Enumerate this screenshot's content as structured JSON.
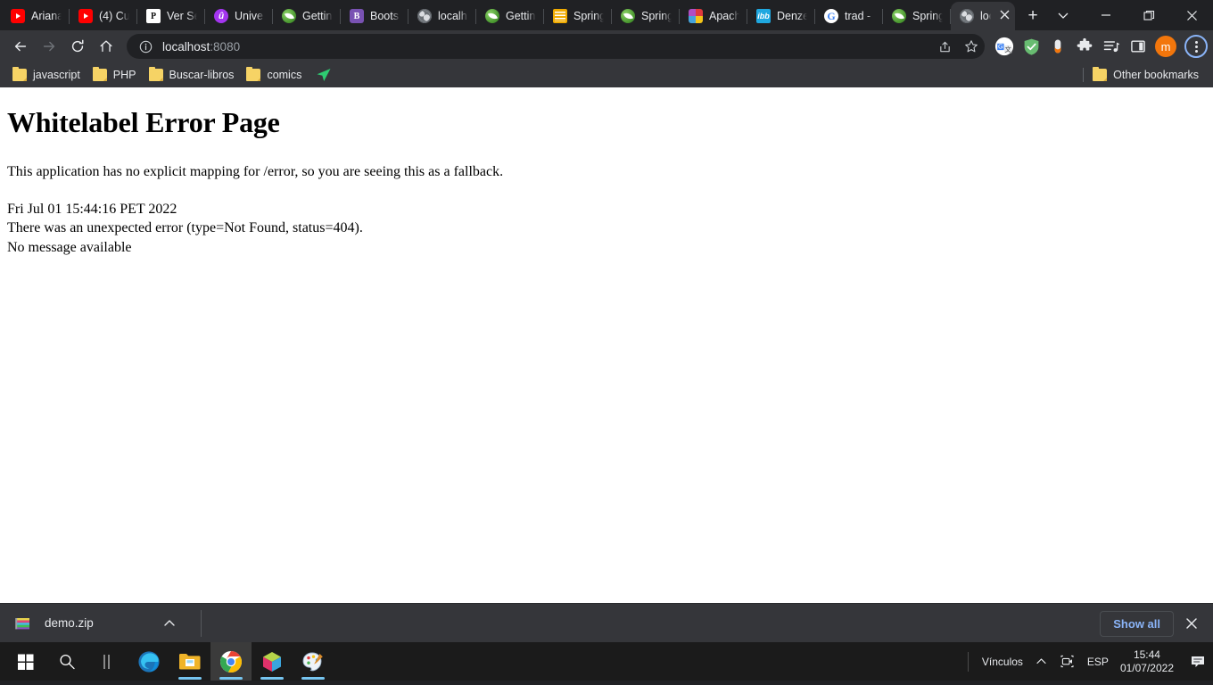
{
  "browser": {
    "tabs": [
      {
        "title": "Ariana",
        "favicon": "youtube-icon",
        "fav_class": "fav-yt",
        "glyph": ""
      },
      {
        "title": "(4) Cu",
        "favicon": "youtube-icon",
        "fav_class": "fav-yt",
        "glyph": ""
      },
      {
        "title": "Ver Se",
        "favicon": "p-letter-icon",
        "fav_class": "fav-p",
        "glyph": "P"
      },
      {
        "title": "Unive",
        "favicon": "udemy-icon",
        "fav_class": "fav-u",
        "glyph": "û"
      },
      {
        "title": "Gettin",
        "favicon": "spring-leaf-icon",
        "fav_class": "fav-spring",
        "glyph": ""
      },
      {
        "title": "Boots",
        "favicon": "bootstrap-icon",
        "fav_class": "fav-b",
        "glyph": "B"
      },
      {
        "title": "localh",
        "favicon": "globe-icon",
        "fav_class": "fav-globe",
        "glyph": ""
      },
      {
        "title": "Gettin",
        "favicon": "spring-leaf-icon",
        "fav_class": "fav-spring",
        "glyph": ""
      },
      {
        "title": "Spring",
        "favicon": "stack-icon",
        "fav_class": "fav-stack",
        "glyph": ""
      },
      {
        "title": "Spring",
        "favicon": "spring-leaf-icon",
        "fav_class": "fav-spring",
        "glyph": ""
      },
      {
        "title": "Apach",
        "favicon": "apache-cube-icon",
        "fav_class": "fav-apache",
        "glyph": ""
      },
      {
        "title": "Denze",
        "favicon": "ibb-icon",
        "fav_class": "fav-ibb",
        "glyph": "ibb"
      },
      {
        "title": "trad -",
        "favicon": "google-icon",
        "fav_class": "fav-g",
        "glyph": "G"
      },
      {
        "title": "Spring",
        "favicon": "spring-leaf-icon",
        "fav_class": "fav-spring",
        "glyph": ""
      }
    ],
    "active_tab": {
      "title": "loc",
      "favicon": "globe-icon",
      "fav_class": "fav-globe",
      "glyph": ""
    },
    "new_tab_label": "+",
    "window_controls": {
      "search_tabs": "⌄",
      "minimize": "—",
      "maximize": "❐",
      "close": "✕"
    },
    "omnibox": {
      "url_host": "localhost",
      "url_port": ":8080",
      "info_icon": "page-info-icon",
      "share_icon": "share-icon",
      "bookmark_icon": "star-icon"
    },
    "extensions": [
      {
        "name": "google-translate-icon"
      },
      {
        "name": "adguard-shield-icon"
      },
      {
        "name": "pill-capsule-icon"
      },
      {
        "name": "extensions-puzzle-icon"
      },
      {
        "name": "reading-list-icon"
      },
      {
        "name": "side-panel-icon"
      }
    ],
    "profile_initial": "m",
    "bookmarks": [
      {
        "label": "javascript",
        "icon": "folder-icon"
      },
      {
        "label": "PHP",
        "icon": "folder-icon"
      },
      {
        "label": "Buscar-libros",
        "icon": "folder-icon"
      },
      {
        "label": "comics",
        "icon": "folder-icon"
      }
    ],
    "bookmark_plane_icon": "paper-plane-icon",
    "other_bookmarks": {
      "label": "Other bookmarks",
      "icon": "folder-icon"
    }
  },
  "page": {
    "title": "Whitelabel Error Page",
    "intro": "This application has no explicit mapping for /error, so you are seeing this as a fallback.",
    "timestamp": "Fri Jul 01 15:44:16 PET 2022",
    "error_line": "There was an unexpected error (type=Not Found, status=404).",
    "message_line": "No message available"
  },
  "downloads": {
    "file_name": "demo.zip",
    "file_icon": "winrar-archive-icon",
    "expand_icon": "chevron-up-icon",
    "show_all_label": "Show all",
    "close_label": "✕"
  },
  "taskbar": {
    "items": [
      {
        "name": "start-button",
        "icon": "windows-logo-icon",
        "active": false,
        "running": false
      },
      {
        "name": "search-button",
        "icon": "search-icon",
        "active": false,
        "running": false
      },
      {
        "name": "task-view-button",
        "icon": "task-view-icon",
        "active": false,
        "running": false
      },
      {
        "name": "edge-button",
        "icon": "edge-icon",
        "active": false,
        "running": false
      },
      {
        "name": "file-explorer-button",
        "icon": "folder-explorer-icon",
        "active": false,
        "running": true
      },
      {
        "name": "chrome-button",
        "icon": "chrome-icon",
        "active": true,
        "running": true
      },
      {
        "name": "3d-viewer-button",
        "icon": "cube-icon",
        "active": false,
        "running": true
      },
      {
        "name": "paint-button",
        "icon": "paint-palette-icon",
        "active": false,
        "running": true
      }
    ],
    "tray": {
      "links_label": "Vínculos",
      "overflow_icon": "chevron-up-icon",
      "camera_icon": "camera-icon",
      "language": "ESP",
      "time": "15:44",
      "date": "01/07/2022",
      "notification_icon": "notification-icon"
    }
  },
  "colors": {
    "chrome_frame": "#202124",
    "chrome_toolbar": "#35363a",
    "omnibox_bg": "#202124",
    "accent_blue": "#8ab4f8",
    "page_bg": "#ffffff",
    "taskbar_bg": "#1b1b1b",
    "taskbar_indicator": "#76c5f0",
    "profile_orange": "#f2760c"
  }
}
